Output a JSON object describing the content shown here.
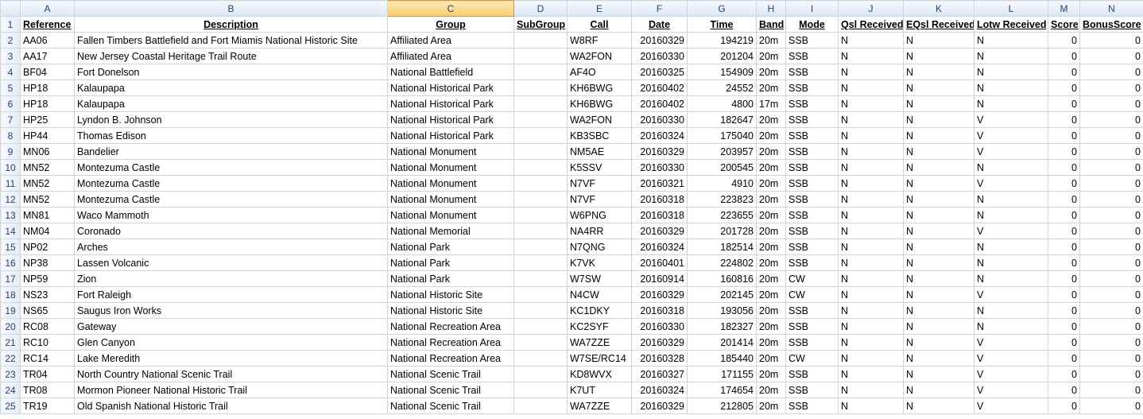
{
  "columns": [
    "A",
    "B",
    "C",
    "D",
    "E",
    "F",
    "G",
    "H",
    "I",
    "J",
    "K",
    "L",
    "M",
    "N"
  ],
  "headers": [
    "Reference",
    "Description",
    "Group",
    "SubGroup",
    "Call",
    "Date",
    "Time",
    "Band",
    "Mode",
    "Qsl Received",
    "EQsl Received",
    "Lotw Received",
    "Score",
    "BonusScore"
  ],
  "rows": [
    {
      "n": "2",
      "c": [
        "AA06",
        "Fallen Timbers Battlefield and Fort Miamis National Historic Site",
        "Affiliated Area",
        "",
        "W8RF",
        "20160329",
        "194219",
        "20m",
        "SSB",
        "N",
        "N",
        "N",
        "0",
        "0"
      ]
    },
    {
      "n": "3",
      "c": [
        "AA17",
        "New Jersey Coastal Heritage Trail Route",
        "Affiliated Area",
        "",
        "WA2FON",
        "20160330",
        "201204",
        "20m",
        "SSB",
        "N",
        "N",
        "N",
        "0",
        "0"
      ]
    },
    {
      "n": "4",
      "c": [
        "BF04",
        "Fort Donelson",
        "National Battlefield",
        "",
        "AF4O",
        "20160325",
        "154909",
        "20m",
        "SSB",
        "N",
        "N",
        "N",
        "0",
        "0"
      ]
    },
    {
      "n": "5",
      "c": [
        "HP18",
        "Kalaupapa",
        "National Historical Park",
        "",
        "KH6BWG",
        "20160402",
        "24552",
        "20m",
        "SSB",
        "N",
        "N",
        "N",
        "0",
        "0"
      ]
    },
    {
      "n": "6",
      "c": [
        "HP18",
        "Kalaupapa",
        "National Historical Park",
        "",
        "KH6BWG",
        "20160402",
        "4800",
        "17m",
        "SSB",
        "N",
        "N",
        "N",
        "0",
        "0"
      ]
    },
    {
      "n": "7",
      "c": [
        "HP25",
        "Lyndon B. Johnson",
        "National Historical Park",
        "",
        "WA2FON",
        "20160330",
        "182647",
        "20m",
        "SSB",
        "N",
        "N",
        "V",
        "0",
        "0"
      ]
    },
    {
      "n": "8",
      "c": [
        "HP44",
        "Thomas Edison",
        "National Historical Park",
        "",
        "KB3SBC",
        "20160324",
        "175040",
        "20m",
        "SSB",
        "N",
        "N",
        "V",
        "0",
        "0"
      ]
    },
    {
      "n": "9",
      "c": [
        "MN06",
        "Bandelier",
        "National Monument",
        "",
        "NM5AE",
        "20160329",
        "203957",
        "20m",
        "SSB",
        "N",
        "N",
        "V",
        "0",
        "0"
      ]
    },
    {
      "n": "10",
      "c": [
        "MN52",
        "Montezuma Castle",
        "National Monument",
        "",
        "K5SSV",
        "20160330",
        "200545",
        "20m",
        "SSB",
        "N",
        "N",
        "N",
        "0",
        "0"
      ]
    },
    {
      "n": "11",
      "c": [
        "MN52",
        "Montezuma Castle",
        "National Monument",
        "",
        "N7VF",
        "20160321",
        "4910",
        "20m",
        "SSB",
        "N",
        "N",
        "V",
        "0",
        "0"
      ]
    },
    {
      "n": "12",
      "c": [
        "MN52",
        "Montezuma Castle",
        "National Monument",
        "",
        "N7VF",
        "20160318",
        "223823",
        "20m",
        "SSB",
        "N",
        "N",
        "N",
        "0",
        "0"
      ]
    },
    {
      "n": "13",
      "c": [
        "MN81",
        "Waco Mammoth",
        "National Monument",
        "",
        "W6PNG",
        "20160318",
        "223655",
        "20m",
        "SSB",
        "N",
        "N",
        "N",
        "0",
        "0"
      ]
    },
    {
      "n": "14",
      "c": [
        "NM04",
        "Coronado",
        "National Memorial",
        "",
        "NA4RR",
        "20160329",
        "201728",
        "20m",
        "SSB",
        "N",
        "N",
        "V",
        "0",
        "0"
      ]
    },
    {
      "n": "15",
      "c": [
        "NP02",
        "Arches",
        "National Park",
        "",
        "N7QNG",
        "20160324",
        "182514",
        "20m",
        "SSB",
        "N",
        "N",
        "N",
        "0",
        "0"
      ]
    },
    {
      "n": "16",
      "c": [
        "NP38",
        "Lassen Volcanic",
        "National Park",
        "",
        "K7VK",
        "20160401",
        "224802",
        "20m",
        "SSB",
        "N",
        "N",
        "N",
        "0",
        "0"
      ]
    },
    {
      "n": "17",
      "c": [
        "NP59",
        "Zion",
        "National Park",
        "",
        "W7SW",
        "20160914",
        "160816",
        "20m",
        "CW",
        "N",
        "N",
        "N",
        "0",
        "0"
      ]
    },
    {
      "n": "18",
      "c": [
        "NS23",
        "Fort Raleigh",
        "National Historic Site",
        "",
        "N4CW",
        "20160329",
        "202145",
        "20m",
        "CW",
        "N",
        "N",
        "V",
        "0",
        "0"
      ]
    },
    {
      "n": "19",
      "c": [
        "NS65",
        "Saugus Iron Works",
        "National Historic Site",
        "",
        "KC1DKY",
        "20160318",
        "193056",
        "20m",
        "SSB",
        "N",
        "N",
        "N",
        "0",
        "0"
      ]
    },
    {
      "n": "20",
      "c": [
        "RC08",
        "Gateway",
        "National Recreation Area",
        "",
        "KC2SYF",
        "20160330",
        "182327",
        "20m",
        "SSB",
        "N",
        "N",
        "N",
        "0",
        "0"
      ]
    },
    {
      "n": "21",
      "c": [
        "RC10",
        "Glen Canyon",
        "National Recreation Area",
        "",
        "WA7ZZE",
        "20160329",
        "201414",
        "20m",
        "SSB",
        "N",
        "N",
        "V",
        "0",
        "0"
      ]
    },
    {
      "n": "22",
      "c": [
        "RC14",
        "Lake Meredith",
        "National Recreation Area",
        "",
        "W7SE/RC14",
        "20160328",
        "185440",
        "20m",
        "CW",
        "N",
        "N",
        "V",
        "0",
        "0"
      ]
    },
    {
      "n": "23",
      "c": [
        "TR04",
        "North Country National Scenic Trail",
        "National Scenic Trail",
        "",
        "KD8WVX",
        "20160327",
        "171155",
        "20m",
        "SSB",
        "N",
        "N",
        "V",
        "0",
        "0"
      ]
    },
    {
      "n": "24",
      "c": [
        "TR08",
        "Mormon Pioneer National Historic Trail",
        "National Scenic Trail",
        "",
        "K7UT",
        "20160324",
        "174654",
        "20m",
        "SSB",
        "N",
        "N",
        "V",
        "0",
        "0"
      ]
    },
    {
      "n": "25",
      "c": [
        "TR19",
        "Old Spanish National Historic Trail",
        "National Scenic Trail",
        "",
        "WA7ZZE",
        "20160329",
        "212805",
        "20m",
        "SSB",
        "N",
        "N",
        "V",
        "0",
        "0"
      ]
    }
  ]
}
